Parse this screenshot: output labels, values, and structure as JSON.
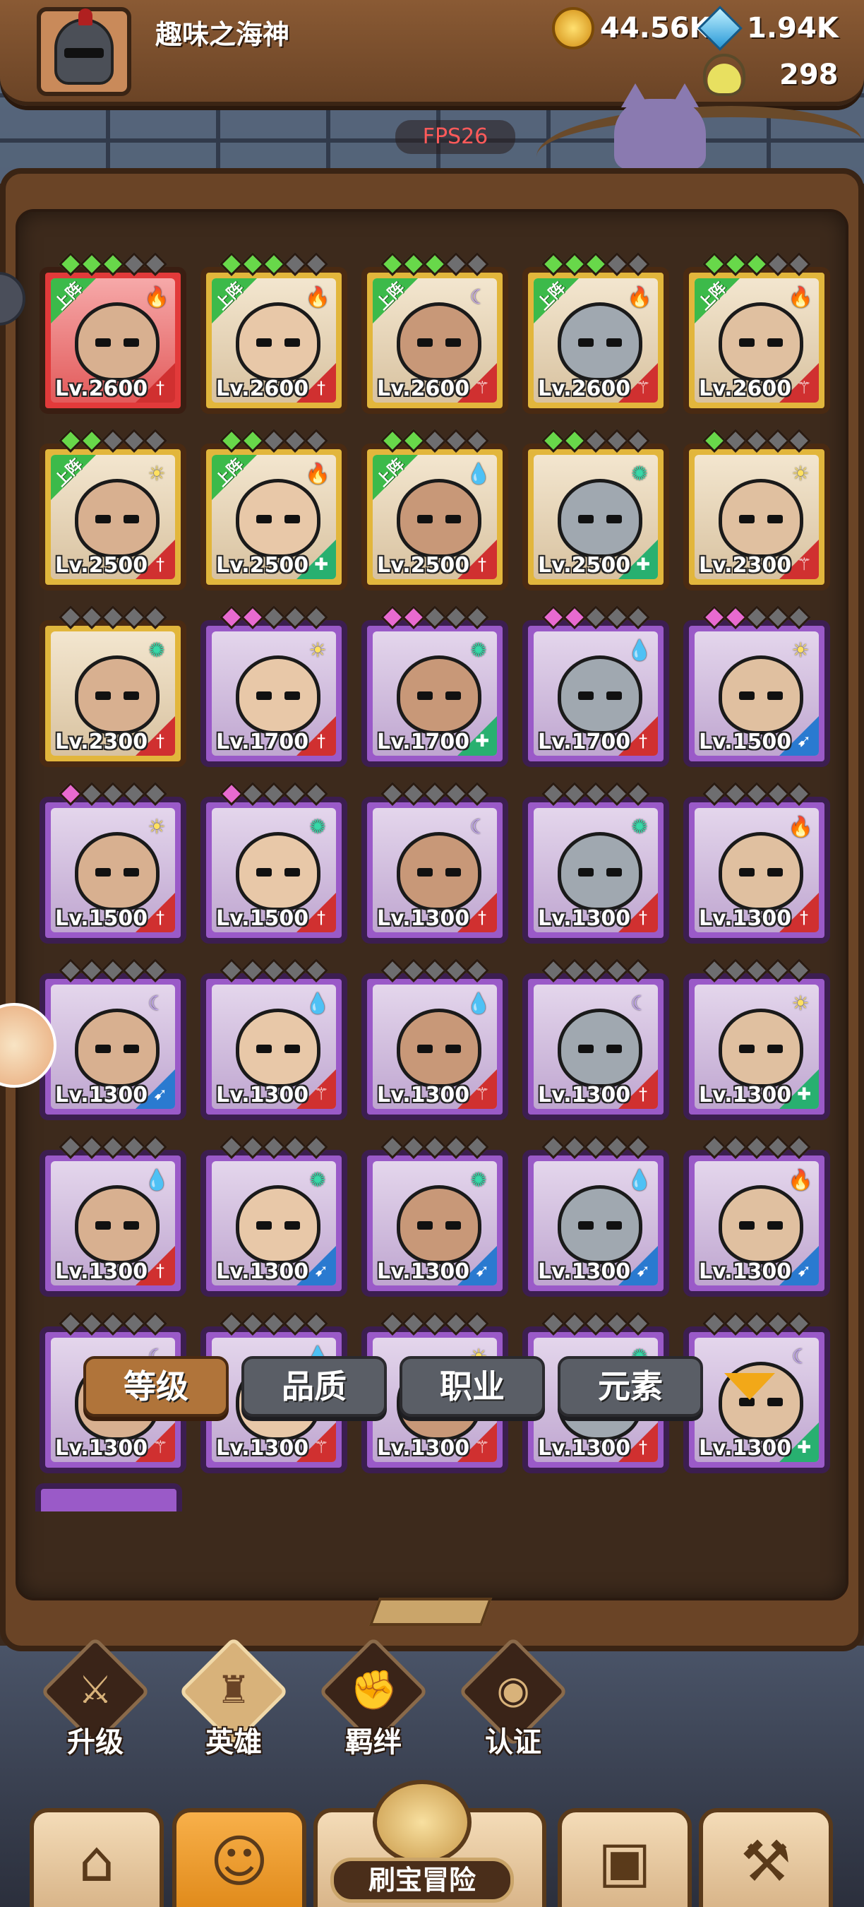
{
  "header": {
    "player_name": "趣味之海神",
    "gold": "44.56K",
    "gems": "1.94K",
    "potion": "298",
    "fps": "FPS26"
  },
  "heroes": [
    {
      "level": "Lv.2600",
      "rarity": "red",
      "deployed": true,
      "element": "fire",
      "stars": [
        "green",
        "green",
        "green",
        "gray",
        "gray"
      ],
      "cls": "melee"
    },
    {
      "level": "Lv.2600",
      "rarity": "gold",
      "deployed": true,
      "element": "fire",
      "stars": [
        "green",
        "green",
        "green",
        "gray",
        "gray"
      ],
      "cls": "melee"
    },
    {
      "level": "Lv.2600",
      "rarity": "gold",
      "deployed": true,
      "element": "moon",
      "stars": [
        "green",
        "green",
        "green",
        "gray",
        "gray"
      ],
      "cls": "mage"
    },
    {
      "level": "Lv.2600",
      "rarity": "gold",
      "deployed": true,
      "element": "fire",
      "stars": [
        "green",
        "green",
        "green",
        "gray",
        "gray"
      ],
      "cls": "mage"
    },
    {
      "level": "Lv.2600",
      "rarity": "gold",
      "deployed": true,
      "element": "fire",
      "stars": [
        "green",
        "green",
        "green",
        "gray",
        "gray"
      ],
      "cls": "mage"
    },
    {
      "level": "Lv.2500",
      "rarity": "gold",
      "deployed": true,
      "element": "sun",
      "stars": [
        "green",
        "green",
        "gray",
        "gray",
        "gray"
      ],
      "cls": "melee"
    },
    {
      "level": "Lv.2500",
      "rarity": "gold",
      "deployed": true,
      "element": "fire",
      "stars": [
        "green",
        "green",
        "gray",
        "gray",
        "gray"
      ],
      "cls": "tank"
    },
    {
      "level": "Lv.2500",
      "rarity": "gold",
      "deployed": true,
      "element": "water",
      "stars": [
        "green",
        "green",
        "gray",
        "gray",
        "gray"
      ],
      "cls": "melee"
    },
    {
      "level": "Lv.2500",
      "rarity": "gold",
      "deployed": false,
      "element": "wind",
      "stars": [
        "green",
        "green",
        "gray",
        "gray",
        "gray"
      ],
      "cls": "tank"
    },
    {
      "level": "Lv.2300",
      "rarity": "gold",
      "deployed": false,
      "element": "sun",
      "stars": [
        "green",
        "gray",
        "gray",
        "gray",
        "gray"
      ],
      "cls": "mage"
    },
    {
      "level": "Lv.2300",
      "rarity": "gold",
      "deployed": false,
      "element": "wind",
      "stars": [
        "gray",
        "gray",
        "gray",
        "gray",
        "gray"
      ],
      "cls": "melee"
    },
    {
      "level": "Lv.1700",
      "rarity": "purple",
      "deployed": false,
      "element": "sun",
      "stars": [
        "pink",
        "pink",
        "gray",
        "gray",
        "gray"
      ],
      "cls": "melee"
    },
    {
      "level": "Lv.1700",
      "rarity": "purple",
      "deployed": false,
      "element": "wind",
      "stars": [
        "pink",
        "pink",
        "gray",
        "gray",
        "gray"
      ],
      "cls": "tank"
    },
    {
      "level": "Lv.1700",
      "rarity": "purple",
      "deployed": false,
      "element": "water",
      "stars": [
        "pink",
        "pink",
        "gray",
        "gray",
        "gray"
      ],
      "cls": "melee"
    },
    {
      "level": "Lv.1500",
      "rarity": "purple",
      "deployed": false,
      "element": "sun",
      "stars": [
        "pink",
        "pink",
        "gray",
        "gray",
        "gray"
      ],
      "cls": "ranged"
    },
    {
      "level": "Lv.1500",
      "rarity": "purple",
      "deployed": false,
      "element": "sun",
      "stars": [
        "pink",
        "gray",
        "gray",
        "gray",
        "gray"
      ],
      "cls": "melee"
    },
    {
      "level": "Lv.1500",
      "rarity": "purple",
      "deployed": false,
      "element": "wind",
      "stars": [
        "pink",
        "gray",
        "gray",
        "gray",
        "gray"
      ],
      "cls": "melee"
    },
    {
      "level": "Lv.1300",
      "rarity": "purple",
      "deployed": false,
      "element": "moon",
      "stars": [
        "gray",
        "gray",
        "gray",
        "gray",
        "gray"
      ],
      "cls": "melee"
    },
    {
      "level": "Lv.1300",
      "rarity": "purple",
      "deployed": false,
      "element": "wind",
      "stars": [
        "gray",
        "gray",
        "gray",
        "gray",
        "gray"
      ],
      "cls": "melee"
    },
    {
      "level": "Lv.1300",
      "rarity": "purple",
      "deployed": false,
      "element": "fire",
      "stars": [
        "gray",
        "gray",
        "gray",
        "gray",
        "gray"
      ],
      "cls": "melee"
    },
    {
      "level": "Lv.1300",
      "rarity": "purple",
      "deployed": false,
      "element": "moon",
      "stars": [
        "gray",
        "gray",
        "gray",
        "gray",
        "gray"
      ],
      "cls": "ranged"
    },
    {
      "level": "Lv.1300",
      "rarity": "purple",
      "deployed": false,
      "element": "water",
      "stars": [
        "gray",
        "gray",
        "gray",
        "gray",
        "gray"
      ],
      "cls": "mage"
    },
    {
      "level": "Lv.1300",
      "rarity": "purple",
      "deployed": false,
      "element": "water",
      "stars": [
        "gray",
        "gray",
        "gray",
        "gray",
        "gray"
      ],
      "cls": "mage"
    },
    {
      "level": "Lv.1300",
      "rarity": "purple",
      "deployed": false,
      "element": "moon",
      "stars": [
        "gray",
        "gray",
        "gray",
        "gray",
        "gray"
      ],
      "cls": "melee"
    },
    {
      "level": "Lv.1300",
      "rarity": "purple",
      "deployed": false,
      "element": "sun",
      "stars": [
        "gray",
        "gray",
        "gray",
        "gray",
        "gray"
      ],
      "cls": "tank"
    },
    {
      "level": "Lv.1300",
      "rarity": "purple",
      "deployed": false,
      "element": "water",
      "stars": [
        "gray",
        "gray",
        "gray",
        "gray",
        "gray"
      ],
      "cls": "melee"
    },
    {
      "level": "Lv.1300",
      "rarity": "purple",
      "deployed": false,
      "element": "wind",
      "stars": [
        "gray",
        "gray",
        "gray",
        "gray",
        "gray"
      ],
      "cls": "ranged"
    },
    {
      "level": "Lv.1300",
      "rarity": "purple",
      "deployed": false,
      "element": "wind",
      "stars": [
        "gray",
        "gray",
        "gray",
        "gray",
        "gray"
      ],
      "cls": "ranged"
    },
    {
      "level": "Lv.1300",
      "rarity": "purple",
      "deployed": false,
      "element": "water",
      "stars": [
        "gray",
        "gray",
        "gray",
        "gray",
        "gray"
      ],
      "cls": "ranged"
    },
    {
      "level": "Lv.1300",
      "rarity": "purple",
      "deployed": false,
      "element": "fire",
      "stars": [
        "gray",
        "gray",
        "gray",
        "gray",
        "gray"
      ],
      "cls": "ranged"
    },
    {
      "level": "Lv.1300",
      "rarity": "purple",
      "deployed": false,
      "element": "moon",
      "stars": [
        "gray",
        "gray",
        "gray",
        "gray",
        "gray"
      ],
      "cls": "mage"
    },
    {
      "level": "Lv.1300",
      "rarity": "purple",
      "deployed": false,
      "element": "water",
      "stars": [
        "gray",
        "gray",
        "gray",
        "gray",
        "gray"
      ],
      "cls": "mage"
    },
    {
      "level": "Lv.1300",
      "rarity": "purple",
      "deployed": false,
      "element": "sun",
      "stars": [
        "gray",
        "gray",
        "gray",
        "gray",
        "gray"
      ],
      "cls": "mage"
    },
    {
      "level": "Lv.1300",
      "rarity": "purple",
      "deployed": false,
      "element": "wind",
      "stars": [
        "gray",
        "gray",
        "gray",
        "gray",
        "gray"
      ],
      "cls": "melee"
    },
    {
      "level": "Lv.1300",
      "rarity": "purple",
      "deployed": false,
      "element": "moon",
      "stars": [
        "gray",
        "gray",
        "gray",
        "gray",
        "gray"
      ],
      "cls": "tank"
    }
  ],
  "deployed_label": "上阵",
  "filters": [
    "等级",
    "品质",
    "职业",
    "元素"
  ],
  "mid_nav": [
    {
      "label": "升级",
      "icon": "sword-icon"
    },
    {
      "label": "英雄",
      "icon": "hero-icon"
    },
    {
      "label": "羁绊",
      "icon": "handshake-icon"
    },
    {
      "label": "认证",
      "icon": "eye-icon"
    }
  ],
  "bottom_nav": {
    "adventure_label": "刷宝冒险",
    "items": [
      "shop-icon",
      "hero-portrait-icon",
      "adventure-icon",
      "backpack-icon",
      "forge-icon"
    ]
  },
  "colors": {
    "gold_frame": "#e2b63c",
    "purple_frame": "#9a5ac8",
    "red_frame": "#e23a3a",
    "deployed_ribbon": "#3cba4a",
    "active_filter": "#b0743a"
  }
}
